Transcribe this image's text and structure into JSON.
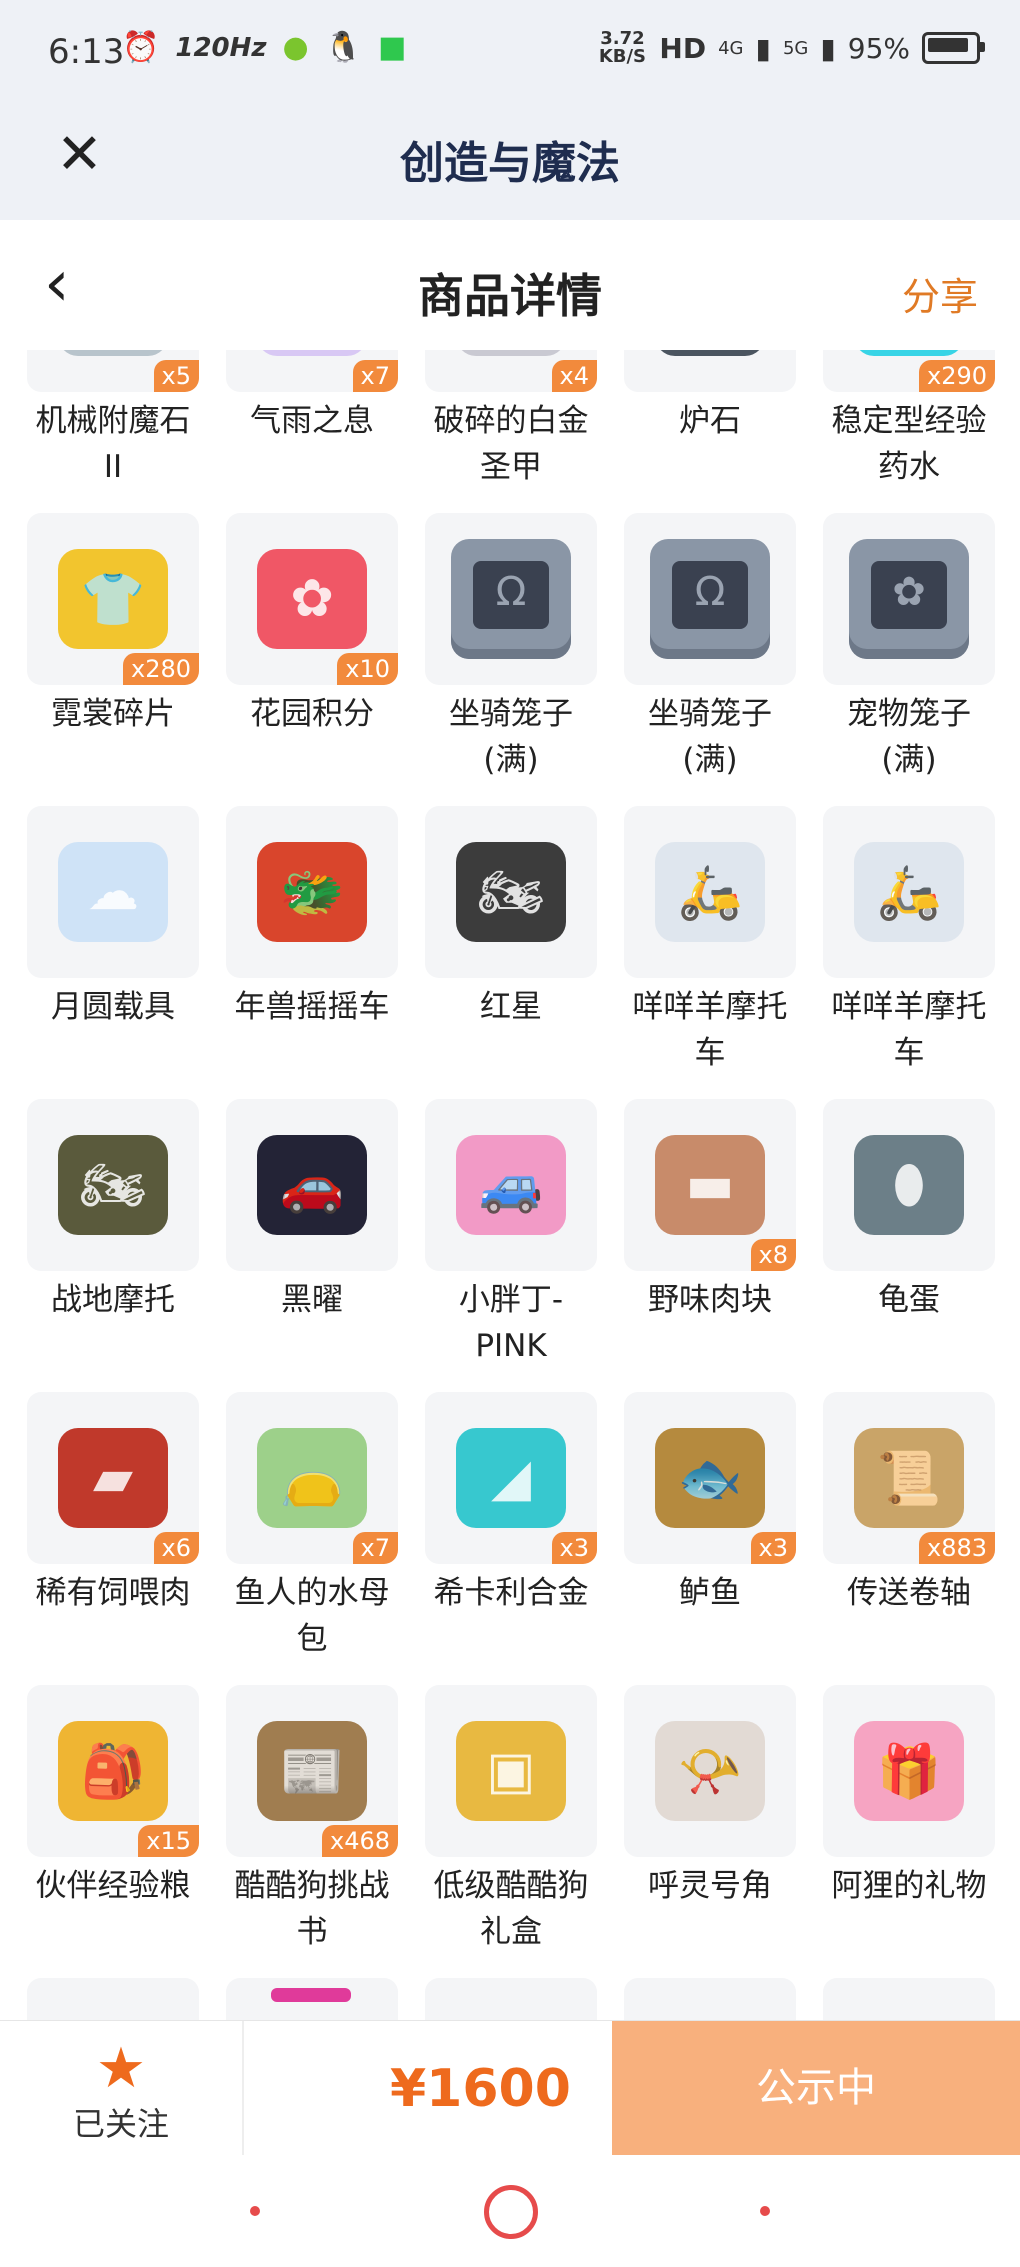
{
  "status_bar": {
    "time": "6:13",
    "refresh": "120Hz",
    "net_speed": "3.72 KB/S",
    "hd": "HD",
    "net1": "4G",
    "net2": "5G",
    "battery": "95%"
  },
  "titlebar": {
    "title": "创造与魔法",
    "close_icon": "close-icon"
  },
  "subheader": {
    "title": "商品详情",
    "share": "分享"
  },
  "items": [
    {
      "name": "机械附魔石II",
      "qty": "x5",
      "icon": "gem-icon",
      "color": "#b8c4cc"
    },
    {
      "name": "气雨之息",
      "qty": "x7",
      "icon": "orb-icon",
      "color": "#d8c8f4"
    },
    {
      "name": "破碎的白金圣甲",
      "qty": "x4",
      "icon": "armor-icon",
      "color": "#c9c9d2"
    },
    {
      "name": "炉石",
      "qty": "",
      "icon": "stone-icon",
      "color": "#4b5560"
    },
    {
      "name": "稳定型经验药水",
      "qty": "x290",
      "icon": "potion-icon",
      "color": "#38d4e6"
    },
    {
      "name": "霓裳碎片",
      "qty": "x280",
      "icon": "shirt-icon",
      "color": "#f2c52e"
    },
    {
      "name": "花园积分",
      "qty": "x10",
      "icon": "flower-icon",
      "color": "#f05766"
    },
    {
      "name": "坐骑笼子(满)",
      "qty": "",
      "icon": "cage-icon",
      "color": "#8a96a6"
    },
    {
      "name": "坐骑笼子(满)",
      "qty": "",
      "icon": "cage-icon",
      "color": "#8a96a6"
    },
    {
      "name": "宠物笼子(满)",
      "qty": "",
      "icon": "cage-icon",
      "color": "#8a96a6"
    },
    {
      "name": "月圆载具",
      "qty": "",
      "icon": "moon-cloud-icon",
      "color": "#cfe3f7"
    },
    {
      "name": "年兽摇摇车",
      "qty": "",
      "icon": "beast-car-icon",
      "color": "#d9452c"
    },
    {
      "name": "红星",
      "qty": "",
      "icon": "motorbike-icon",
      "color": "#3c3c3c"
    },
    {
      "name": "咩咩羊摩托车",
      "qty": "",
      "icon": "scooter-icon",
      "color": "#dfe6ee"
    },
    {
      "name": "咩咩羊摩托车",
      "qty": "",
      "icon": "scooter-icon",
      "color": "#dfe6ee"
    },
    {
      "name": "战地摩托",
      "qty": "",
      "icon": "war-bike-icon",
      "color": "#5a5a3c"
    },
    {
      "name": "黑曜",
      "qty": "",
      "icon": "car-icon",
      "color": "#232336"
    },
    {
      "name": "小胖丁-PINK",
      "qty": "",
      "icon": "beetle-car-icon",
      "color": "#f29ac6"
    },
    {
      "name": "野味肉块",
      "qty": "x8",
      "icon": "meat-icon",
      "color": "#c88b6a"
    },
    {
      "name": "龟蛋",
      "qty": "",
      "icon": "egg-icon",
      "color": "#6c7f88"
    },
    {
      "name": "稀有饲喂肉",
      "qty": "x6",
      "icon": "steak-icon",
      "color": "#c0392b"
    },
    {
      "name": "鱼人的水母包",
      "qty": "x7",
      "icon": "pouch-icon",
      "color": "#9dd08a"
    },
    {
      "name": "希卡利合金",
      "qty": "x3",
      "icon": "crystal-icon",
      "color": "#37c8cf"
    },
    {
      "name": "鲈鱼",
      "qty": "x3",
      "icon": "fish-icon",
      "color": "#b58a3e"
    },
    {
      "name": "传送卷轴",
      "qty": "x883",
      "icon": "scroll-icon",
      "color": "#c9a468"
    },
    {
      "name": "伙伴经验粮",
      "qty": "x15",
      "icon": "bag-icon",
      "color": "#efb533"
    },
    {
      "name": "酷酷狗挑战书",
      "qty": "x468",
      "icon": "wanted-icon",
      "color": "#a07d50"
    },
    {
      "name": "低级酷酷狗礼盒",
      "qty": "",
      "icon": "box-icon",
      "color": "#e8b941"
    },
    {
      "name": "呼灵号角",
      "qty": "",
      "icon": "horn-icon",
      "color": "#e2dad4"
    },
    {
      "name": "阿狸的礼物",
      "qty": "",
      "icon": "gift-icon",
      "color": "#f6a4c2"
    },
    {
      "name": "",
      "qty": "",
      "icon": "",
      "color": "#f4f5f7"
    },
    {
      "name": "",
      "qty": "",
      "icon": "",
      "color": "#e03a9a"
    },
    {
      "name": "",
      "qty": "",
      "icon": "",
      "color": "#f4f5f7"
    },
    {
      "name": "",
      "qty": "",
      "icon": "",
      "color": "#f4f5f7"
    },
    {
      "name": "",
      "qty": "",
      "icon": "",
      "color": "#f4f5f7"
    }
  ],
  "bottom": {
    "follow_label": "已关注",
    "price": "¥1600",
    "status": "公示中"
  }
}
